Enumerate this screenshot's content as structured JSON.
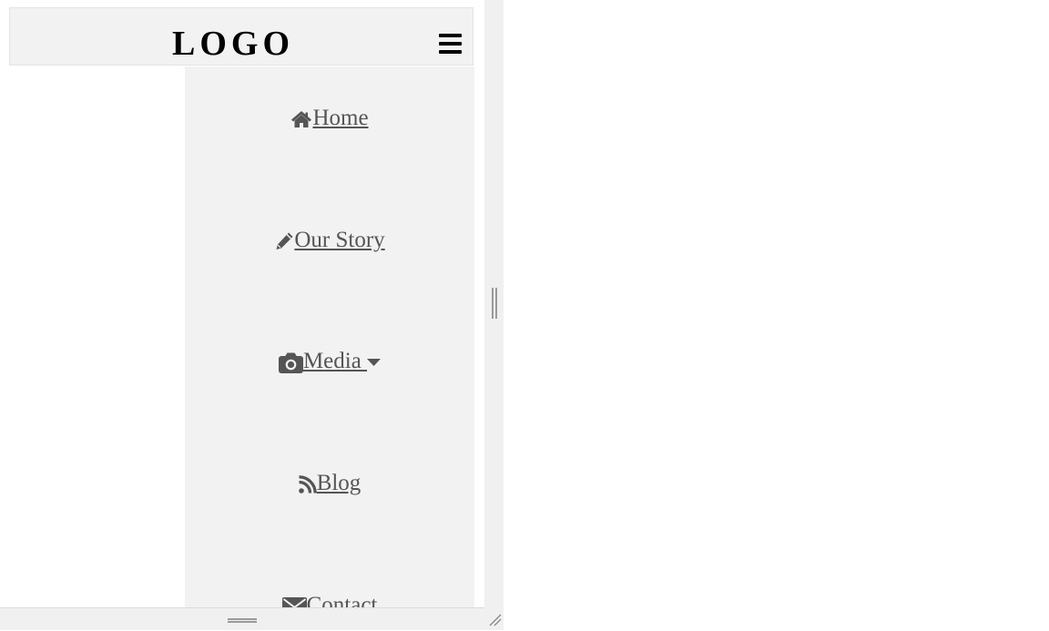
{
  "header": {
    "logo": "LOGO",
    "menu_icon": "hamburger-menu-icon"
  },
  "nav": {
    "items": [
      {
        "label": "Home",
        "icon": "home-icon"
      },
      {
        "label": "Our Story",
        "icon": "pencil-icon"
      },
      {
        "label": "Media ",
        "icon": "camera-icon",
        "dropdown_icon": "caret-down-icon"
      },
      {
        "label": "Blog",
        "icon": "rss-icon"
      },
      {
        "label": "Contact",
        "icon": "envelope-icon"
      }
    ]
  },
  "colors": {
    "header_bg": "#f2f2f2",
    "nav_bg": "#f2f2f2",
    "nav_text": "#555555",
    "logo_text": "#000000"
  }
}
